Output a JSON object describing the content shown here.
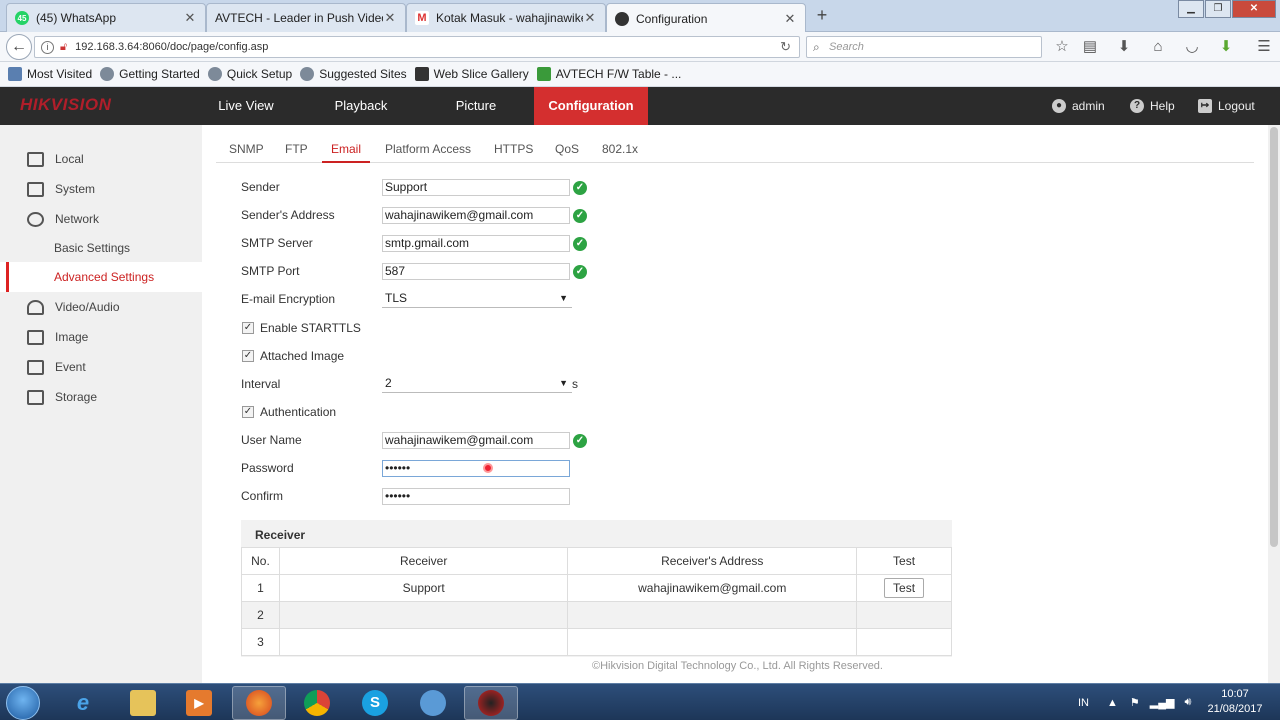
{
  "browser": {
    "tabs": [
      {
        "title": "(45) WhatsApp",
        "icon": "whatsapp-icon"
      },
      {
        "title": "AVTECH - Leader in Push Video I",
        "icon": "avtech-icon"
      },
      {
        "title": "Kotak Masuk - wahajinawikem",
        "icon": "gmail-icon"
      },
      {
        "title": "Configuration",
        "icon": "hikvision-icon"
      }
    ],
    "url": "192.168.3.64:8060/doc/page/config.asp",
    "search_placeholder": "Search",
    "bookmarks": [
      "Most Visited",
      "Getting Started",
      "Quick Setup",
      "Suggested Sites",
      "Web Slice Gallery",
      "AVTECH F/W Table - ..."
    ]
  },
  "app": {
    "logo": "HIKVISION",
    "menu": [
      "Live View",
      "Playback",
      "Picture",
      "Configuration"
    ],
    "user": "admin",
    "help": "Help",
    "logout": "Logout"
  },
  "sidebar": {
    "items": [
      "Local",
      "System",
      "Network",
      "Basic Settings",
      "Advanced Settings",
      "Video/Audio",
      "Image",
      "Event",
      "Storage"
    ]
  },
  "subtabs": [
    "SNMP",
    "FTP",
    "Email",
    "Platform Access",
    "HTTPS",
    "QoS",
    "802.1x"
  ],
  "form": {
    "sender_label": "Sender",
    "sender_value": "Support",
    "sender_address_label": "Sender's Address",
    "sender_address_value": "wahajinawikem@gmail.com",
    "smtp_server_label": "SMTP Server",
    "smtp_server_value": "smtp.gmail.com",
    "smtp_port_label": "SMTP Port",
    "smtp_port_value": "587",
    "encryption_label": "E-mail Encryption",
    "encryption_value": "TLS",
    "starttls_label": "Enable STARTTLS",
    "attached_image_label": "Attached Image",
    "interval_label": "Interval",
    "interval_value": "2",
    "interval_unit": "s",
    "authentication_label": "Authentication",
    "username_label": "User Name",
    "username_value": "wahajinawikem@gmail.com",
    "password_label": "Password",
    "password_value": "••••••",
    "confirm_label": "Confirm",
    "confirm_value": "••••••"
  },
  "receiver": {
    "title": "Receiver",
    "headers": [
      "No.",
      "Receiver",
      "Receiver's Address",
      "Test"
    ],
    "rows": [
      {
        "no": "1",
        "name": "Support",
        "address": "wahajinawikem@gmail.com",
        "test": "Test"
      },
      {
        "no": "2",
        "name": "",
        "address": "",
        "test": ""
      },
      {
        "no": "3",
        "name": "",
        "address": "",
        "test": ""
      }
    ]
  },
  "footer": "©Hikvision Digital Technology Co., Ltd. All Rights Reserved.",
  "taskbar": {
    "lang": "IN",
    "time": "10:07",
    "date": "21/08/2017"
  },
  "colors": {
    "accent": "#d42f2f",
    "ok": "#2da343",
    "header_bg": "#2b2b2b"
  }
}
